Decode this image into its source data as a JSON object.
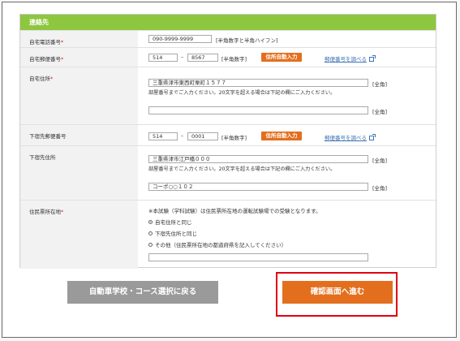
{
  "section_title": "連絡先",
  "required_mark": "*",
  "rows": {
    "home_phone": {
      "label": "自宅電話番号",
      "value": "090-9999-9999",
      "hint": "[半角数字と半角ハイフン]"
    },
    "home_postal": {
      "label": "自宅郵便番号",
      "value1": "514",
      "dash": "–",
      "value2": "8567",
      "hint": "[半角数字]",
      "auto_button": "住所自動入力",
      "lookup_link": "郵便番号を調べる"
    },
    "home_address": {
      "label": "自宅住所",
      "value1": "三重県津市東西町栗町１５７７",
      "hint1": "[全角]",
      "note": "部屋番号までご入力ください。20文字を超える場合は下記の欄にご入力ください。",
      "value2": "",
      "hint2": "[全角]"
    },
    "lodging_postal": {
      "label": "下宿先郵便番号",
      "value1": "514",
      "dash": "–",
      "value2": "0001",
      "hint": "[半角数字]",
      "auto_button": "住所自動入力",
      "lookup_link": "郵便番号を調べる"
    },
    "lodging_address": {
      "label": "下宿先住所",
      "value1": "三重県津市江戸橋０００",
      "hint1": "[全角]",
      "note": "部屋番号までご入力ください。20文字を超える場合は下記の欄にご入力ください。",
      "value2": "コーポ○○１０２",
      "hint2": "[全角]"
    },
    "residence": {
      "label": "住民票所在地",
      "note": "※本試験（学科試験）は住民票所在地の運転試験場での受験となります。",
      "options": [
        "自宅住所と同じ",
        "下宿先住所と同じ",
        "その他（住民票所在地の都道府県を記入してください）"
      ],
      "selected_index": 0,
      "other_value": ""
    }
  },
  "buttons": {
    "back": "自動車学校・コース選択に戻る",
    "next": "確認画面へ進む"
  },
  "colors": {
    "header_green": "#8dc63f",
    "accent_orange": "#e36f1e",
    "highlight_red": "#e00012",
    "back_gray": "#9a9a9a",
    "link_blue": "#3f74b5"
  }
}
